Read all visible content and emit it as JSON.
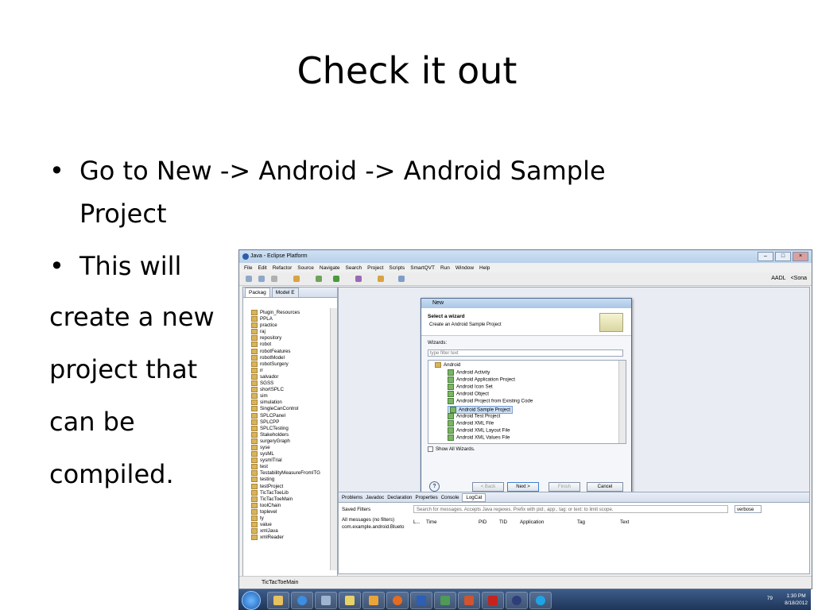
{
  "slide": {
    "title": "Check it out",
    "bullets": [
      "Go to New -> Android -> Android Sample",
      "Project",
      "This will"
    ],
    "lines": [
      "create a new",
      "project that",
      "can be",
      "compiled."
    ]
  },
  "window": {
    "title": "Java - Eclipse Platform",
    "menu": [
      "File",
      "Edit",
      "Refactor",
      "Source",
      "Navigate",
      "Search",
      "Project",
      "Scripts",
      "SmartQVT",
      "Run",
      "Window",
      "Help"
    ],
    "perspectives": [
      "AADL",
      "<Sona"
    ]
  },
  "package_explorer": {
    "tabs": [
      "Packag",
      "Model E"
    ],
    "items": [
      "Plugin_Resources",
      "PPLA",
      "practice",
      "raj",
      "repository",
      "robot",
      "robotFeatures",
      "robotModel",
      "robotSurgery",
      "rr",
      "salvador",
      "SGSS",
      "shortSPLC",
      "sim",
      "simulation",
      "SingleCanControl",
      "SPLCPanel",
      "SPLCPP",
      "SPLCTesting",
      "Stakeholders",
      "surgeryGraph",
      "syse",
      "sysML",
      "sysmlTrial",
      "test",
      "TestabilityMeasureFromITG",
      "testing",
      "testProject",
      "TicTacToeLib",
      "TicTacToeMain",
      "toolChain",
      "toplevel",
      "ty",
      "value",
      "xmlJava",
      "xmlReader"
    ],
    "status": "TicTacToeMain"
  },
  "dialog": {
    "title": "New",
    "heading": "Select a wizard",
    "description": "Create an Android Sample Project",
    "wizards_label": "Wizards:",
    "filter_placeholder": "type filter text",
    "root": "Android",
    "items": [
      "Android Activity",
      "Android Application Project",
      "Android Icon Set",
      "Android Object",
      "Android Project from Existing Code",
      "Android Sample Project",
      "Android Test Project",
      "Android XML File",
      "Android XML Layout File",
      "Android XML Values File"
    ],
    "selected": "Android Sample Project",
    "show_all": "Show All Wizards.",
    "buttons": {
      "back": "< Back",
      "next": "Next >",
      "finish": "Finish",
      "cancel": "Cancel"
    }
  },
  "console": {
    "tabs": [
      "Problems",
      "Javadoc",
      "Declaration",
      "Properties",
      "Console",
      "LogCat"
    ],
    "saved_filters": "Saved Filters",
    "filters": [
      "All messages (no filters)",
      "com.example.android.Blueto"
    ],
    "search_placeholder": "Search for messages. Accepts Java regexes. Prefix with pid:, app:, tag: or text: to limit scope.",
    "level": "verbose",
    "columns": [
      "L...",
      "Time",
      "PID",
      "TID",
      "Application",
      "Tag",
      "Text"
    ]
  },
  "taskbar": {
    "time": "1:30 PM",
    "date": "8/18/2012",
    "tray_badge": "79"
  },
  "colors": {
    "accent": "#2f5ea8",
    "selection": "#cfe0f7",
    "taskbar": "#1f3558"
  }
}
